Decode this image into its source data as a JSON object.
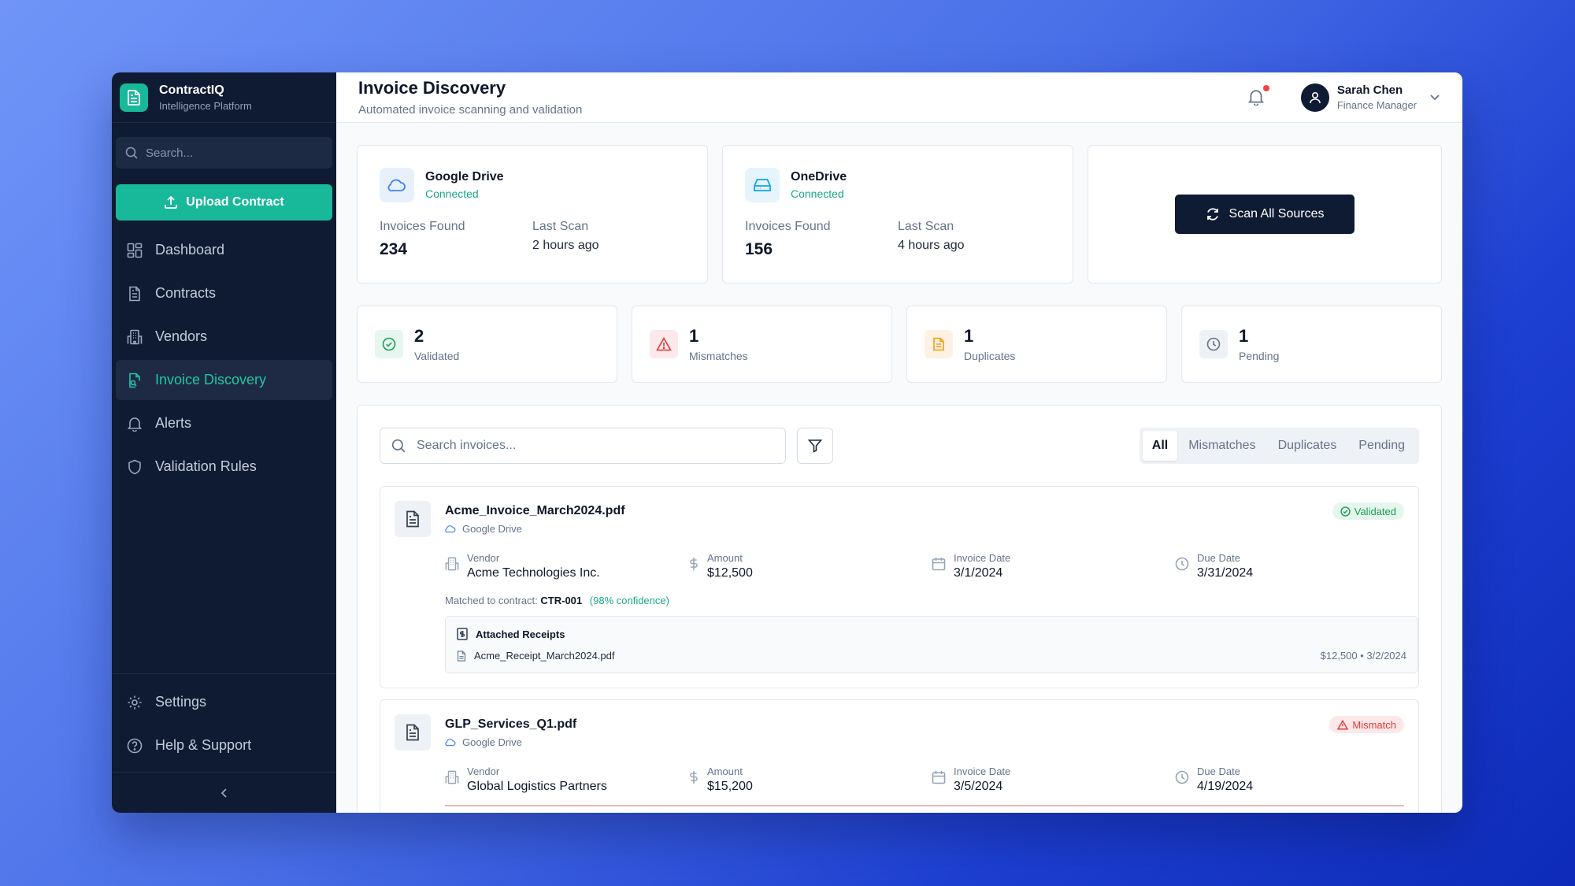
{
  "brand": {
    "name": "ContractIQ",
    "subtitle": "Intelligence Platform"
  },
  "sidebar": {
    "search_placeholder": "Search...",
    "upload_label": "Upload Contract",
    "items": [
      {
        "label": "Dashboard",
        "icon": "dashboard-icon"
      },
      {
        "label": "Contracts",
        "icon": "document-icon"
      },
      {
        "label": "Vendors",
        "icon": "building-icon"
      },
      {
        "label": "Invoice Discovery",
        "icon": "file-search-icon",
        "active": true
      },
      {
        "label": "Alerts",
        "icon": "bell-icon"
      },
      {
        "label": "Validation Rules",
        "icon": "shield-icon"
      }
    ],
    "bottom": [
      {
        "label": "Settings",
        "icon": "gear-icon"
      },
      {
        "label": "Help & Support",
        "icon": "help-icon"
      }
    ]
  },
  "header": {
    "title": "Invoice Discovery",
    "subtitle": "Automated invoice scanning and validation",
    "user": {
      "name": "Sarah Chen",
      "role": "Finance Manager"
    }
  },
  "sources": [
    {
      "name": "Google Drive",
      "status": "Connected",
      "invoices_label": "Invoices Found",
      "invoices": "234",
      "scan_label": "Last Scan",
      "scan": "2 hours ago"
    },
    {
      "name": "OneDrive",
      "status": "Connected",
      "invoices_label": "Invoices Found",
      "invoices": "156",
      "scan_label": "Last Scan",
      "scan": "4 hours ago"
    }
  ],
  "scan_button": "Scan All Sources",
  "summary": [
    {
      "count": "2",
      "label": "Validated",
      "color": "#18a056"
    },
    {
      "count": "1",
      "label": "Mismatches",
      "color": "#e03a3a"
    },
    {
      "count": "1",
      "label": "Duplicates",
      "color": "#f59e0b"
    },
    {
      "count": "1",
      "label": "Pending",
      "color": "#64748b"
    }
  ],
  "list": {
    "search_placeholder": "Search invoices...",
    "tabs": [
      "All",
      "Mismatches",
      "Duplicates",
      "Pending"
    ],
    "invoices": [
      {
        "file": "Acme_Invoice_March2024.pdf",
        "source": "Google Drive",
        "status": "Validated",
        "vendor_label": "Vendor",
        "vendor": "Acme Technologies Inc.",
        "amount_label": "Amount",
        "amount": "$12,500",
        "invoice_date_label": "Invoice Date",
        "invoice_date": "3/1/2024",
        "due_date_label": "Due Date",
        "due_date": "3/31/2024",
        "match_prefix": "Matched to contract:",
        "contract": "CTR-001",
        "confidence": "(98% confidence)",
        "receipts_title": "Attached Receipts",
        "receipt_file": "Acme_Receipt_March2024.pdf",
        "receipt_meta": "$12,500 • 3/2/2024"
      },
      {
        "file": "GLP_Services_Q1.pdf",
        "source": "Google Drive",
        "status": "Mismatch",
        "vendor_label": "Vendor",
        "vendor": "Global Logistics Partners",
        "amount_label": "Amount",
        "amount": "$15,200",
        "invoice_date_label": "Invoice Date",
        "invoice_date": "3/5/2024",
        "due_date_label": "Due Date",
        "due_date": "4/19/2024"
      }
    ]
  },
  "colors": {
    "accent": "#18b89a",
    "sidebar_bg": "#0f1b33",
    "active_text": "#21c6a3"
  }
}
